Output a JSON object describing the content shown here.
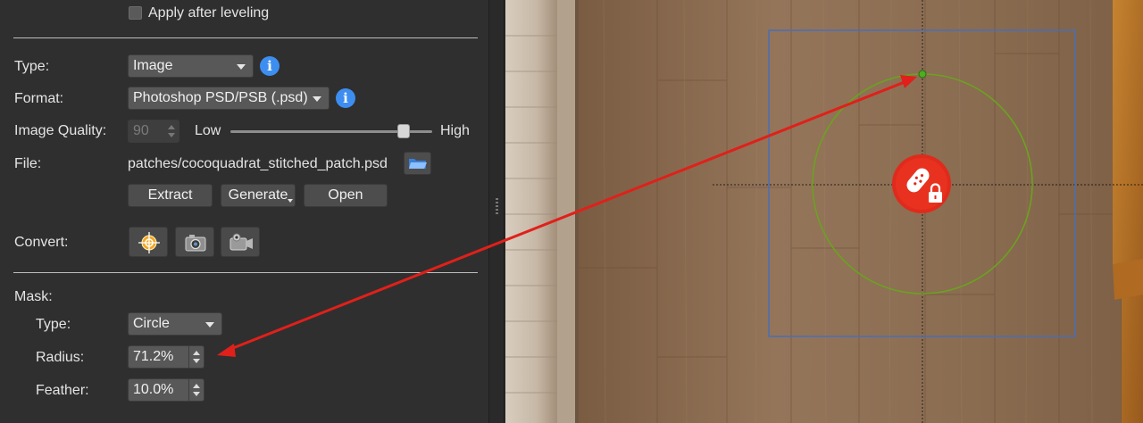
{
  "top": {
    "apply_after_leveling": {
      "label": "Apply after leveling",
      "checked": false
    }
  },
  "output": {
    "type_label": "Type:",
    "type_value": "Image",
    "format_label": "Format:",
    "format_value": "Photoshop PSD/PSB (.psd)",
    "quality_label": "Image Quality:",
    "quality_value": "90",
    "quality_low": "Low",
    "quality_high": "High",
    "quality_slider_fraction": 0.88,
    "file_label": "File:",
    "file_value": "patches/cocoquadrat_stitched_patch.psd",
    "buttons": {
      "extract": "Extract",
      "generate": "Generate",
      "open": "Open"
    },
    "convert_label": "Convert:",
    "convert_icons": [
      "target-icon",
      "camera-icon",
      "video-camera-icon"
    ]
  },
  "mask": {
    "heading": "Mask:",
    "type_label": "Type:",
    "type_value": "Circle",
    "radius_label": "Radius:",
    "radius_value": "71.2%",
    "feather_label": "Feather:",
    "feather_value": "10.0%"
  },
  "colors": {
    "panel_bg": "#2f2f2f",
    "info_blue": "#3d8ef0",
    "annotation_arrow": "#e0201a",
    "mask_circle": "#6aa31e",
    "selection_box": "#4a6fb5",
    "patch_badge": "#e02a1c"
  }
}
